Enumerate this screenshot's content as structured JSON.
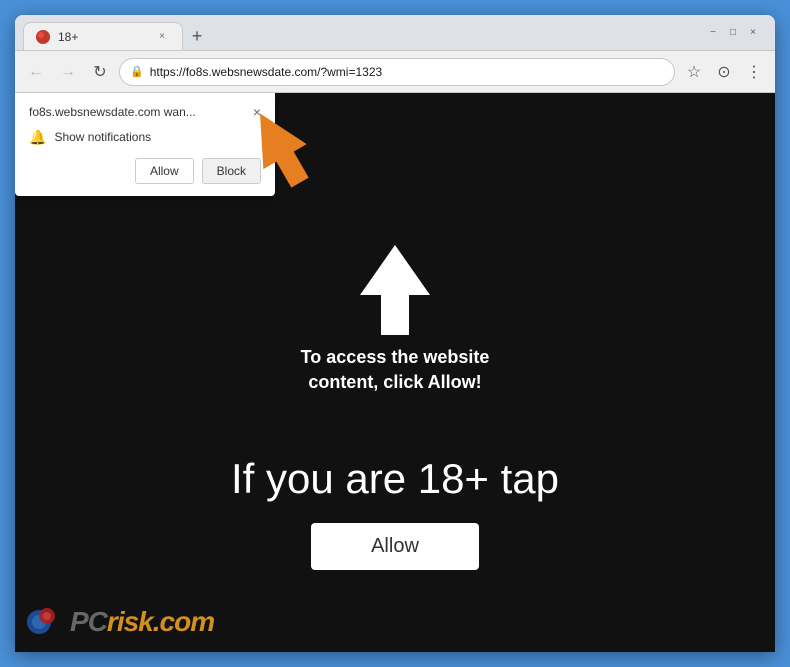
{
  "browser": {
    "tab": {
      "favicon_alt": "site icon",
      "title": "18+",
      "close_label": "×"
    },
    "new_tab_label": "+",
    "window_controls": {
      "minimize": "−",
      "maximize": "□",
      "close": "×"
    },
    "nav": {
      "back_label": "←",
      "forward_label": "→",
      "refresh_label": "↻",
      "address": "https://fo8s.websnewsdate.com/?wmi=1323",
      "lock_icon": "🔒",
      "star_label": "☆",
      "account_label": "⊙",
      "menu_label": "⋮"
    }
  },
  "popup": {
    "site_text": "fo8s.websnewsdate.com wan...",
    "close_label": "×",
    "bell_icon": "🔔",
    "notification_label": "Show notifications",
    "allow_label": "Allow",
    "block_label": "Block"
  },
  "page": {
    "instruction_line1": "To access the website",
    "instruction_line2": "content, click Allow!",
    "age_text": "If you are 18+ tap",
    "allow_button_label": "Allow"
  },
  "watermark": {
    "text_pc": "PC",
    "text_risk": "risk",
    "text_dot": ".",
    "text_com": "com"
  }
}
